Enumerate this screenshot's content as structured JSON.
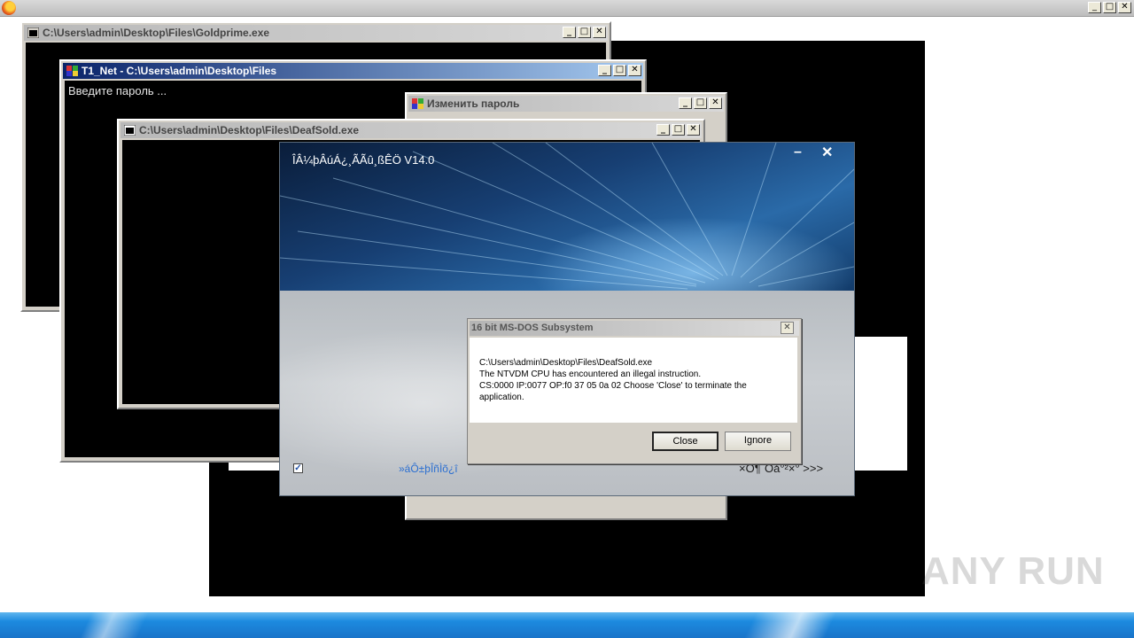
{
  "browser_bar": {
    "logo_icon": "firefox-icon",
    "buttons": [
      "minimize",
      "maximize",
      "close"
    ]
  },
  "windows": {
    "goldprime": {
      "title": "C:\\Users\\admin\\Desktop\\Files\\Goldprime.exe"
    },
    "t1net": {
      "title": "T1_Net - C:\\Users\\admin\\Desktop\\Files",
      "content": "Введите пароль ..."
    },
    "change_password": {
      "title": "Изменить пароль"
    },
    "deafsold": {
      "title": "C:\\Users\\admin\\Desktop\\Files\\DeafSold.exe"
    }
  },
  "installer": {
    "title": "ÎÂ¼þÂúÁ¿¸ÃÃû¸ßÊÖ V14.0",
    "minimize_glyph": "–",
    "close_glyph": "✕",
    "checkbox_checked": true,
    "checkbox_glyph": "✓",
    "link_text": "»áÔ±þÎñÌõ¿î",
    "next_text": "×Ô¶¨Òå°²×° >>>"
  },
  "dialog": {
    "title": "16 bit MS-DOS Subsystem",
    "close_glyph": "✕",
    "message_lines": [
      "C:\\Users\\admin\\Desktop\\Files\\DeafSold.exe",
      "The NTVDM CPU has encountered an illegal instruction.",
      "CS:0000 IP:0077 OP:f0 37 05 0a 02 Choose 'Close' to terminate the application."
    ],
    "buttons": {
      "close": "Close",
      "ignore": "Ignore"
    }
  },
  "watermark": {
    "text": "ANY RUN"
  },
  "colors": {
    "taskbar": "#1a74c9",
    "console": "#000000",
    "dialog_face": "#d4d0c8",
    "link": "#2b6fd1"
  }
}
